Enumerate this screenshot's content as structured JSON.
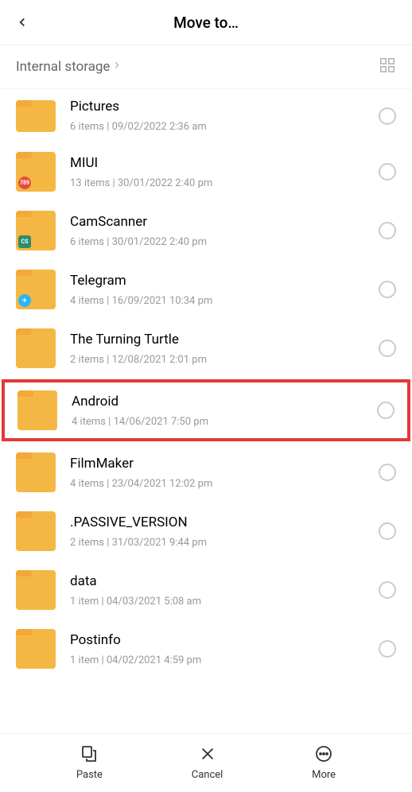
{
  "header": {
    "title": "Move to…"
  },
  "breadcrumb": {
    "label": "Internal storage"
  },
  "items": [
    {
      "name": "Pictures",
      "meta": "6 items  |  09/02/2022 2:36 am",
      "partial": true
    },
    {
      "name": "MIUI",
      "meta": "13 items  |  30/01/2022 2:40 pm",
      "badge": "red",
      "badgeText": "789"
    },
    {
      "name": "CamScanner",
      "meta": "6 items  |  30/01/2022 2:40 pm",
      "badge": "green",
      "badgeText": "CS"
    },
    {
      "name": "Telegram",
      "meta": "4 items  |  16/09/2021 10:34 pm",
      "badge": "blue",
      "badgeText": "✈"
    },
    {
      "name": "The Turning Turtle",
      "meta": "2 items  |  12/08/2021 2:01 pm"
    },
    {
      "name": "Android",
      "meta": "4 items  |  14/06/2021 7:50 pm",
      "highlighted": true
    },
    {
      "name": "FilmMaker",
      "meta": "4 items  |  23/04/2021 12:02 pm"
    },
    {
      "name": ".PASSIVE_VERSION",
      "meta": "2 items  |  31/03/2021 9:44 pm"
    },
    {
      "name": "data",
      "meta": "1 item  |  04/03/2021 5:08 am"
    },
    {
      "name": "Postinfo",
      "meta": "1 item  |  04/02/2021 4:59 pm"
    }
  ],
  "actions": {
    "paste": "Paste",
    "cancel": "Cancel",
    "more": "More"
  }
}
